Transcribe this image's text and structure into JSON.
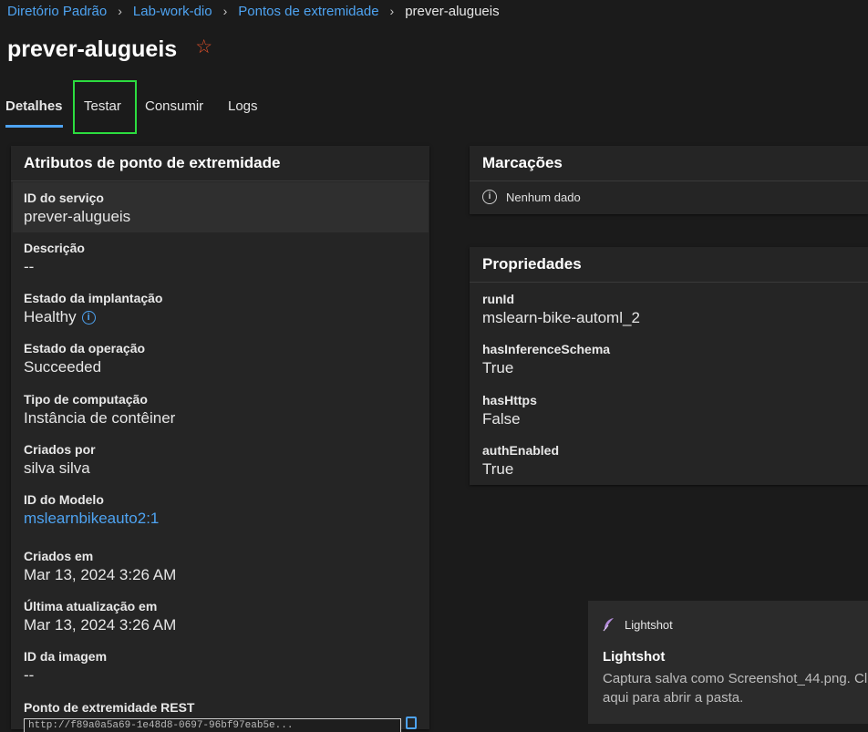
{
  "breadcrumb": {
    "items": [
      "Diretório Padrão",
      "Lab-work-dio",
      "Pontos de extremidade"
    ],
    "current": "prever-alugueis"
  },
  "page": {
    "title": "prever-alugueis"
  },
  "tabs": [
    {
      "label": "Detalhes",
      "active": true
    },
    {
      "label": "Testar",
      "active": false
    },
    {
      "label": "Consumir",
      "active": false
    },
    {
      "label": "Logs",
      "active": false
    }
  ],
  "attributes": {
    "header": "Atributos de ponto de extremidade",
    "items": [
      {
        "label": "ID do serviço",
        "value": "prever-alugueis"
      },
      {
        "label": "Descrição",
        "value": "--"
      },
      {
        "label": "Estado da implantação",
        "value": "Healthy"
      },
      {
        "label": "Estado da operação",
        "value": "Succeeded"
      },
      {
        "label": "Tipo de computação",
        "value": "Instância de contêiner"
      },
      {
        "label": "Criados por",
        "value": "silva silva"
      },
      {
        "label": "ID do Modelo",
        "value": "mslearnbikeauto2:1"
      },
      {
        "label": "Criados em",
        "value": "Mar 13, 2024 3:26 AM"
      },
      {
        "label": "Última atualização em",
        "value": "Mar 13, 2024 3:26 AM"
      },
      {
        "label": "ID da imagem",
        "value": "--"
      },
      {
        "label": "Ponto de extremidade REST",
        "value": "http://f89a0a5a69-1e48d8-0697-96bf97eab5e..."
      }
    ]
  },
  "tags": {
    "header": "Marcações",
    "empty_text": "Nenhum dado"
  },
  "properties": {
    "header": "Propriedades",
    "items": [
      {
        "label": "runId",
        "value": "mslearn-bike-automl_2"
      },
      {
        "label": "hasInferenceSchema",
        "value": "True"
      },
      {
        "label": "hasHttps",
        "value": "False"
      },
      {
        "label": "authEnabled",
        "value": "True"
      }
    ]
  },
  "toast": {
    "app": "Lightshot",
    "title": "Lightshot",
    "body": "Captura salva como Screenshot_44.png. Cl aqui para abrir a pasta."
  },
  "colors": {
    "accent": "#4ea3f1",
    "highlight_box": "#2cdc3f",
    "star": "#e0502a"
  }
}
